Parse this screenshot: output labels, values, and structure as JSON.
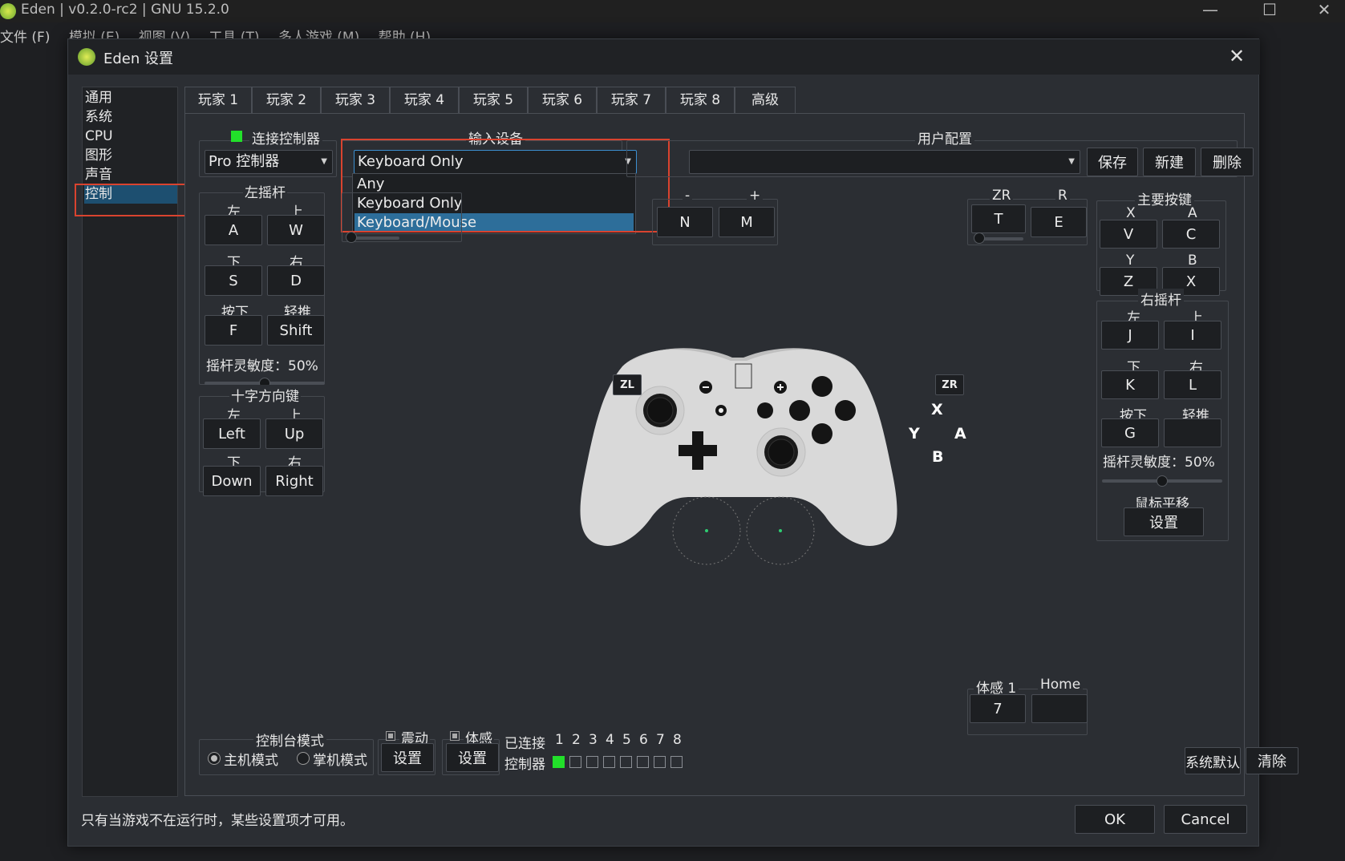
{
  "window": {
    "title": "Eden | v0.2.0-rc2 | GNU 15.2.0"
  },
  "menu": [
    "文件 (F)",
    "模拟 (E)",
    "视图 (V)",
    "工具 (T)",
    "多人游戏 (M)",
    "帮助 (H)"
  ],
  "dialog": {
    "title": "Eden 设置"
  },
  "sidebar": {
    "items": [
      {
        "label": "通用"
      },
      {
        "label": "系统"
      },
      {
        "label": "CPU"
      },
      {
        "label": "图形"
      },
      {
        "label": "声音"
      },
      {
        "label": "控制",
        "selected": true
      }
    ]
  },
  "tabs": [
    {
      "label": "玩家 1",
      "selected": true
    },
    {
      "label": "玩家 2"
    },
    {
      "label": "玩家 3"
    },
    {
      "label": "玩家 4"
    },
    {
      "label": "玩家 5"
    },
    {
      "label": "玩家 6"
    },
    {
      "label": "玩家 7"
    },
    {
      "label": "玩家 8"
    },
    {
      "label": "高级"
    }
  ],
  "controller": {
    "connect_label": "连接控制器",
    "type_value": "Pro 控制器",
    "input_device_label": "输入设备",
    "input_device_value": "Keyboard Only",
    "input_device_options": [
      "Any",
      "Keyboard Only",
      "Keyboard/Mouse"
    ],
    "input_device_highlighted": "Keyboard/Mouse",
    "profile_label": "用户配置",
    "profile_value": "",
    "save": "保存",
    "new": "新建",
    "delete": "删除"
  },
  "left_stick": {
    "title": "左摇杆",
    "left_label": "左",
    "left": "A",
    "up_label": "上",
    "up": "W",
    "down_label": "下",
    "down": "S",
    "right_label": "右",
    "right": "D",
    "press_label": "按下",
    "press": "F",
    "modifier_label": "轻推",
    "modifier": "Shift",
    "sensitivity": "摇杆灵敏度：50%",
    "sensitivity_value": 0.5
  },
  "dpad": {
    "title": "十字方向键",
    "left_label": "左",
    "left": "Left",
    "up_label": "上",
    "up": "Up",
    "down_label": "下",
    "down": "Down",
    "right_label": "右",
    "right": "Right"
  },
  "center_buttons": {
    "minus_label": "-",
    "minus": "N",
    "plus_label": "+",
    "plus": "M"
  },
  "shoulder_right": {
    "zr_label": "ZR",
    "zr": "T",
    "r_label": "R",
    "r": "E"
  },
  "face_buttons": {
    "title": "主要按键",
    "x_label": "X",
    "x": "V",
    "a_label": "A",
    "a": "C",
    "y_label": "Y",
    "y": "Z",
    "b_label": "B",
    "b": "X"
  },
  "right_stick": {
    "title": "右摇杆",
    "left_label": "左",
    "left": "J",
    "up_label": "上",
    "up": "I",
    "down_label": "下",
    "down": "K",
    "right_label": "右",
    "right": "L",
    "press_label": "按下",
    "press": "G",
    "modifier_label": "轻推",
    "modifier": "",
    "sensitivity": "摇杆灵敏度：50%",
    "sensitivity_value": 0.5,
    "mouse_pan_label": "鼠标平移",
    "mouse_pan_button": "设置"
  },
  "controller_image": {
    "zl": "ZL",
    "zr": "ZR",
    "x": "X",
    "y": "Y",
    "a": "A",
    "b": "B"
  },
  "misc": {
    "motion_label": "体感 1",
    "motion": "7",
    "home_label": "Home",
    "home": ""
  },
  "console_mode": {
    "title": "控制台模式",
    "docked": "主机模式",
    "handheld": "掌机模式",
    "docked_selected": true
  },
  "vibration": {
    "label": "震动",
    "button": "设置"
  },
  "motion": {
    "label": "体感",
    "button": "设置"
  },
  "connected": {
    "label": "已连接",
    "numbers": [
      "1",
      "2",
      "3",
      "4",
      "5",
      "6",
      "7",
      "8"
    ],
    "controller_label": "控制器",
    "states": [
      true,
      false,
      false,
      false,
      false,
      false,
      false,
      false
    ],
    "on_color": "#22e02a"
  },
  "defaults_button": "系统默认",
  "clear_button": "清除",
  "footer_note": "只有当游戏不在运行时，某些设置项才可用。",
  "ok": "OK",
  "cancel": "Cancel",
  "colors": {
    "highlight": "#d9432f",
    "selection": "#1d4f70",
    "dropdown_selection": "#2d6e9a"
  }
}
